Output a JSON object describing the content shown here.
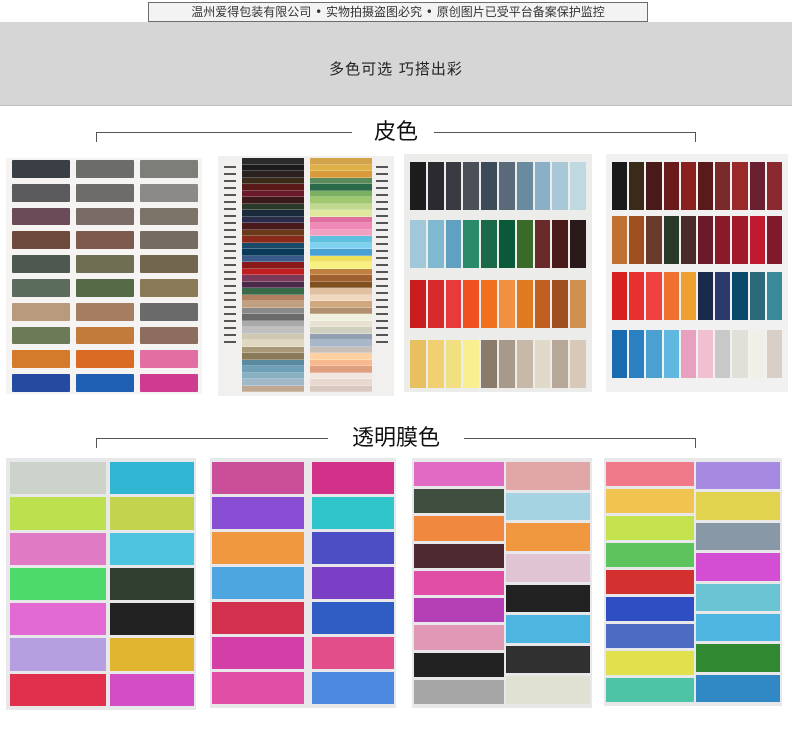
{
  "banner": {
    "text": "温州爱得包装有限公司 • 实物拍摄盗图必究 • 原创图片已受平台备案保护监控"
  },
  "header": {
    "slogan": "多色可选   巧搭出彩"
  },
  "sections": {
    "leather_title": "皮色",
    "film_title": "透明膜色"
  },
  "colors": {
    "panel1": [
      "#3a3f45",
      "#6c6c6b",
      "#7d7d79",
      "#5b5a5c",
      "#6e6c6a",
      "#8b8a89",
      "#6b4b57",
      "#7a6b67",
      "#7c7467",
      "#6e4a3e",
      "#7e5a4d",
      "#766b63",
      "#4e5750",
      "#6e6e52",
      "#73664e",
      "#5b6b5c",
      "#556b47",
      "#8b7a58",
      "#b89a7c",
      "#a67d60",
      "#6a6a6a",
      "#6d7a58",
      "#c37b3b",
      "#8c6d5e",
      "#d37a2b",
      "#d96b24",
      "#e26ea2",
      "#254aa0",
      "#1f5fb2",
      "#cf3b8e",
      "#c2203e",
      "#d6b02a",
      "#6a8fb4",
      "#5b8f3b",
      "#c7a13e",
      "#7a7a7a",
      "#3d8c4a",
      "#a04b2a",
      "#888888",
      "#4a7a5a"
    ],
    "panel2_left": [
      "#2a2a2a",
      "#1a1a1a",
      "#2b2020",
      "#3a2a1a",
      "#5a1a1a",
      "#6a1a2a",
      "#3a1a1a",
      "#2a3a2a",
      "#1a2a3a",
      "#2a2a4a",
      "#4a1a1a",
      "#6a3a1a",
      "#8a2a1a",
      "#1a4a6a",
      "#0a3a5a",
      "#3a5a8a",
      "#8a1a1a",
      "#c02020",
      "#7a3a5a",
      "#4a2a4a",
      "#3a6a4a",
      "#b08060",
      "#c0a080",
      "#8a8a8a",
      "#6a6a6a",
      "#aaaaaa",
      "#c0c0c0",
      "#d0c8b0",
      "#e0d8c0",
      "#a89878",
      "#8a7a5a",
      "#5a8aa0",
      "#70a0b8",
      "#88b0c0",
      "#a0b8c8",
      "#c0a890"
    ],
    "panel2_right": [
      "#d4a44a",
      "#e0b048",
      "#d89a3a",
      "#5a8a5a",
      "#2a6a4a",
      "#7ab060",
      "#a0c870",
      "#c0d890",
      "#e0e8a0",
      "#e070a0",
      "#f088b8",
      "#f0a0c0",
      "#60c0e0",
      "#80d0f0",
      "#4aa0d0",
      "#f0e060",
      "#f8f080",
      "#c08040",
      "#a06030",
      "#805020",
      "#e0c0a0",
      "#f0d8c0",
      "#d0a880",
      "#b09070",
      "#f0f0e0",
      "#e8e0d0",
      "#d0d0c0",
      "#90a0b0",
      "#a8b8c8",
      "#c8c0b8",
      "#ffd0a0",
      "#f8b890",
      "#e0a080",
      "#f0e8e0",
      "#e8d8d0",
      "#d8c8c0"
    ],
    "panel3_rows": [
      [
        "#1c1c1c",
        "#2a2a30",
        "#3a3a42",
        "#4a4f58",
        "#3c4a5a",
        "#5a6a7a",
        "#6a8aa0",
        "#8ab0c8",
        "#a8c8d8",
        "#c0d8e0"
      ],
      [
        "#a0c8d8",
        "#80b8d0",
        "#60a0c0",
        "#2a8a6a",
        "#1a6a4a",
        "#0a5a3a",
        "#3a6a2a",
        "#6a2a2a",
        "#4a1a1a",
        "#2a1a1a"
      ],
      [
        "#c81e1e",
        "#d82a2a",
        "#e83a3a",
        "#f05020",
        "#f07020",
        "#f09040",
        "#e07a20",
        "#c06020",
        "#a05020",
        "#d09050"
      ],
      [
        "#e8c060",
        "#f0d070",
        "#f0e080",
        "#f8f090",
        "#8a7a6a",
        "#a89a8a",
        "#c8b8a8",
        "#e0d8c8",
        "#b8a898",
        "#d8c8b8"
      ]
    ],
    "panel4_rows": [
      [
        "#1a1a1a",
        "#3a2a1a",
        "#4a1a1a",
        "#6a1a1a",
        "#8a2020",
        "#5a1a1a",
        "#7a2a2a",
        "#9a2a2a",
        "#6a2030",
        "#8a2a30"
      ],
      [
        "#c07030",
        "#a05020",
        "#6a3a2a",
        "#2a3a2a",
        "#4a2a2a",
        "#6a1a2a",
        "#8a1a2a",
        "#a01a2a",
        "#c01a30",
        "#801a2a"
      ],
      [
        "#d82020",
        "#e83030",
        "#f04040",
        "#f07030",
        "#f0a030",
        "#1a2a4a",
        "#2a3a6a",
        "#0a4a6a",
        "#2a6a7a",
        "#3a8a9a"
      ],
      [
        "#1a6ab0",
        "#2a80c0",
        "#4aa0d0",
        "#60b8e0",
        "#e8a0c0",
        "#f0c0d0",
        "#c8c8c8",
        "#e0e0d8",
        "#f0f0e8",
        "#d8d0c8"
      ]
    ],
    "film1_left": [
      "#c8d0c8",
      "#b8e040",
      "#e070c0",
      "#40d860",
      "#e060d0",
      "#b098e0",
      "#e02040"
    ],
    "film1_right": [
      "#20b0d0",
      "#c0d040",
      "#40c0e0",
      "#203020",
      "#101010",
      "#e0b020",
      "#d040c0"
    ],
    "film2_left": [
      "#c84090",
      "#8040d0",
      "#f09030",
      "#40a0e0",
      "#d02040",
      "#d030a0",
      "#e040a0"
    ],
    "film2_right": [
      "#d02080",
      "#20c0c8",
      "#4040c0",
      "#7030c0",
      "#2050c0",
      "#e04080",
      "#4080e0"
    ],
    "film3_left": [
      "#e060c0",
      "#304030",
      "#f08030",
      "#401820",
      "#e040a0",
      "#b030b0",
      "#e090b0",
      "#101010",
      "#a0a0a0"
    ],
    "film3_right": [
      "#e0a0a0",
      "#a0d0e0",
      "#f09030",
      "#e0c0d0",
      "#101010",
      "#40b0e0",
      "#202020",
      "#e0e0d0"
    ],
    "film4_left": [
      "#f07080",
      "#f0c040",
      "#c0e040",
      "#50c050",
      "#d02020",
      "#2040c0",
      "#4060c0",
      "#e0e040",
      "#40c0a0"
    ],
    "film4_right": [
      "#a080e0",
      "#e0d040",
      "#8090a0",
      "#d040d0",
      "#60c0d0",
      "#40b0e0",
      "#208020",
      "#2080c0"
    ]
  }
}
